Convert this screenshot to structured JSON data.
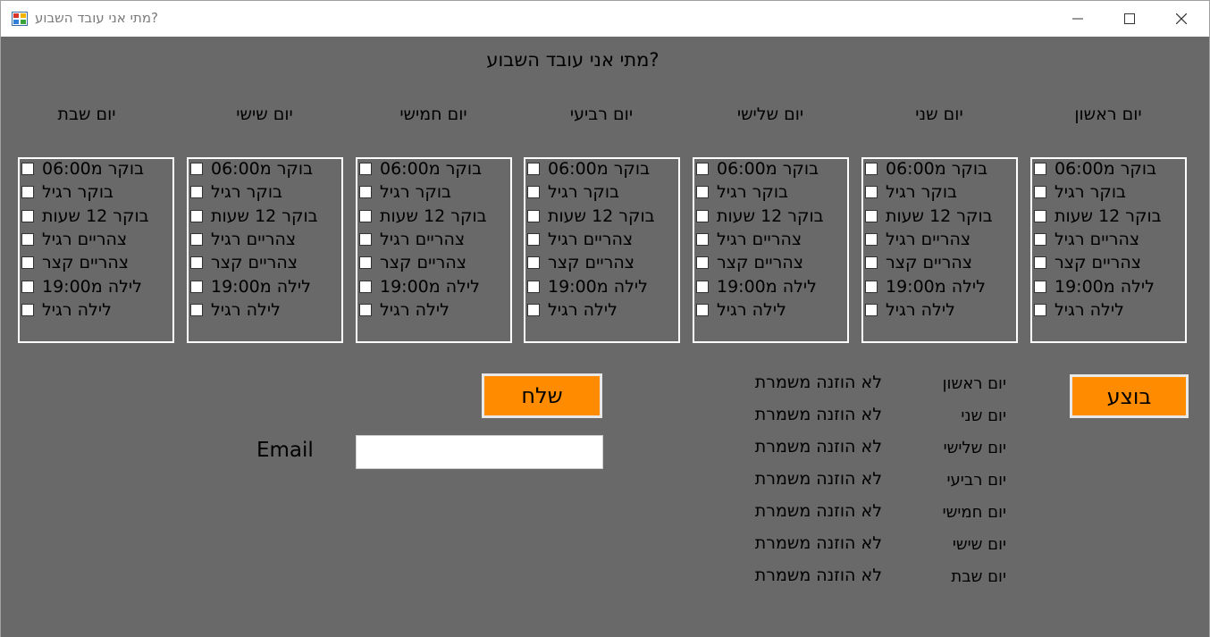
{
  "window": {
    "title": "מתי אני עובד השבוע?",
    "controls": {
      "minimize": "minimize-icon",
      "maximize": "maximize-icon",
      "close": "close-icon"
    }
  },
  "form": {
    "heading": "מתי אני עובד השבוע?",
    "shifts": [
      "בוקר מ06:00",
      "בוקר רגיל",
      "בוקר 12 שעות",
      "צהריים רגיל",
      "צהריים קצר",
      "לילה מ19:00",
      "לילה רגיל"
    ],
    "days": [
      {
        "label": "יום ראשון"
      },
      {
        "label": "יום שני"
      },
      {
        "label": "יום שלישי"
      },
      {
        "label": "יום רביעי"
      },
      {
        "label": "יום חמישי"
      },
      {
        "label": "יום שישי"
      },
      {
        "label": "יום שבת"
      }
    ],
    "execute_button": "בוצע",
    "send_button": "שלח",
    "email": {
      "label": "Email",
      "value": "",
      "placeholder": ""
    },
    "summary": [
      {
        "day": "יום ראשון",
        "status": "לא הוזנה משמרת"
      },
      {
        "day": "יום שני",
        "status": "לא הוזנה משמרת"
      },
      {
        "day": "יום שלישי",
        "status": "לא הוזנה משמרת"
      },
      {
        "day": "יום רביעי",
        "status": "לא הוזנה משמרת"
      },
      {
        "day": "יום חמישי",
        "status": "לא הוזנה משמרת"
      },
      {
        "day": "יום שישי",
        "status": "לא הוזנה משמרת"
      },
      {
        "day": "יום שבת",
        "status": "לא הוזנה משמרת"
      }
    ]
  },
  "colors": {
    "form_background": "#696969",
    "button_background": "#ff8c00",
    "checklist_border": "#ffffff",
    "text": "#000000"
  }
}
